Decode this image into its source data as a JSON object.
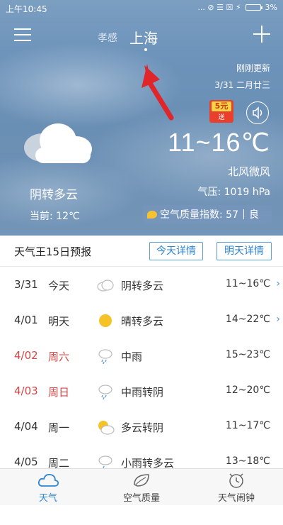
{
  "status_bar": {
    "time": "上午10:45",
    "icons_text": "... ⊘ ☰ ☒ ⚡",
    "battery": "3%"
  },
  "header": {
    "city_prev": "孝感",
    "city_current": "上海"
  },
  "update_info": {
    "updated": "刚刚更新",
    "date": "3/31 二月廿三"
  },
  "coupon": {
    "amount": "5元",
    "sub": "送"
  },
  "today": {
    "temp_range": "11~16℃",
    "wind": "北风微风",
    "pressure": "气压: 1019 hPa",
    "condition": "阴转多云",
    "current_temp": "当前: 12℃",
    "aqi_label": "空气质量指数: 57",
    "aqi_level": "良"
  },
  "forecast_header": {
    "title": "天气王15日预报",
    "today_detail": "今天详情",
    "tomorrow_detail": "明天详情"
  },
  "forecast": [
    {
      "date": "3/31",
      "day": "今天",
      "icon": "overcast-icon",
      "weather": "阴转多云",
      "range": "11~16℃",
      "chevron": "›",
      "weekend": false
    },
    {
      "date": "4/01",
      "day": "明天",
      "icon": "sun-icon",
      "weather": "晴转多云",
      "range": "14~22℃",
      "chevron": "›",
      "weekend": false
    },
    {
      "date": "4/02",
      "day": "周六",
      "icon": "rain-icon",
      "weather": "中雨",
      "range": "15~23℃",
      "chevron": "",
      "weekend": true
    },
    {
      "date": "4/03",
      "day": "周日",
      "icon": "rain-icon",
      "weather": "中雨转阴",
      "range": "12~20℃",
      "chevron": "",
      "weekend": true
    },
    {
      "date": "4/04",
      "day": "周一",
      "icon": "partly-cloudy-icon",
      "weather": "多云转阴",
      "range": "11~17℃",
      "chevron": "",
      "weekend": false
    },
    {
      "date": "4/05",
      "day": "周二",
      "icon": "rain-icon",
      "weather": "小雨转多云",
      "range": "13~18℃",
      "chevron": "",
      "weekend": false
    }
  ],
  "tabs": [
    {
      "label": "天气",
      "icon": "cloud-icon",
      "active": true
    },
    {
      "label": "空气质量",
      "icon": "leaf-icon",
      "active": false
    },
    {
      "label": "天气闹钟",
      "icon": "alarm-clock-icon",
      "active": false
    }
  ],
  "colors": {
    "accent": "#2f86d3",
    "weekend": "#d74646",
    "hero_bg": "#6d93ba",
    "arrow": "#e0262b"
  }
}
